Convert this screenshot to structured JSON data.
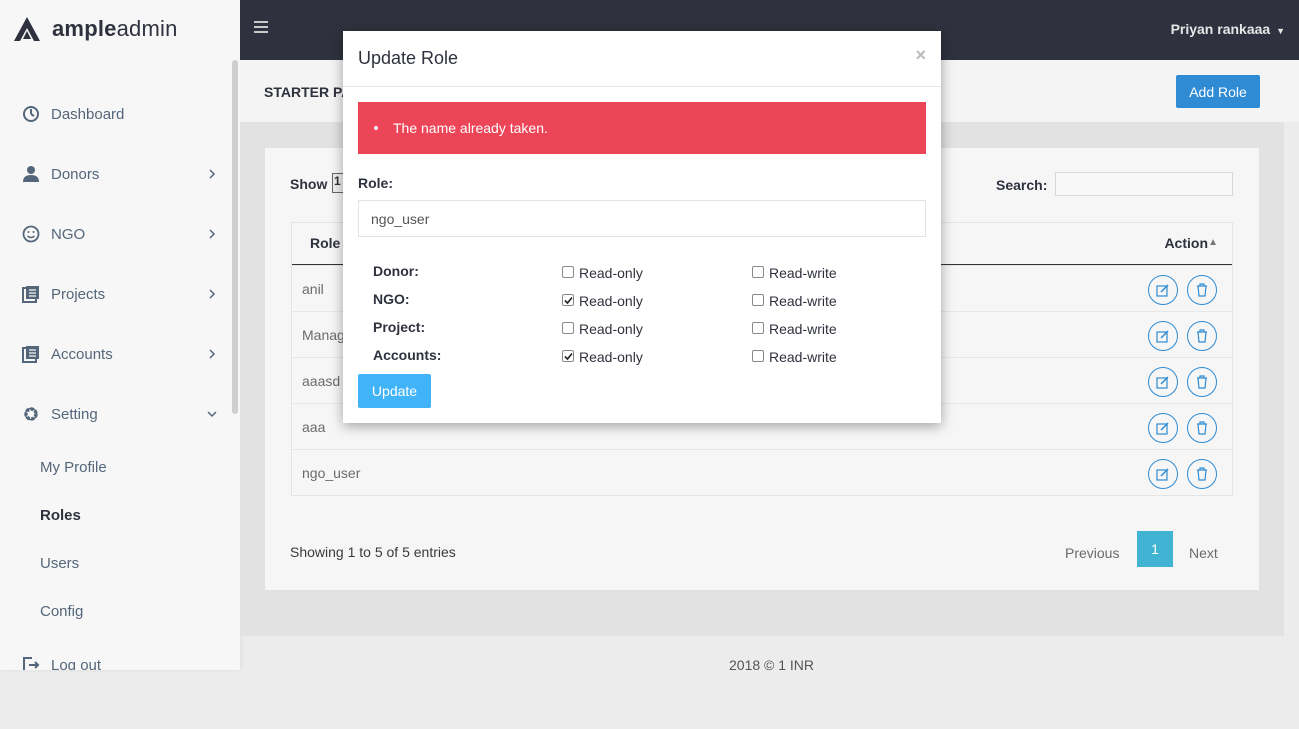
{
  "brand": {
    "bold": "ample",
    "light": "admin"
  },
  "topbar": {
    "user": "Priyan rankaaa"
  },
  "sidebar": {
    "items": [
      {
        "label": "Dashboard",
        "icon": "dashboard-icon"
      },
      {
        "label": "Donors",
        "icon": "user-icon"
      },
      {
        "label": "NGO",
        "icon": "smiley-icon"
      },
      {
        "label": "Projects",
        "icon": "list-icon"
      },
      {
        "label": "Accounts",
        "icon": "list-icon"
      },
      {
        "label": "Setting",
        "icon": "gear-icon"
      }
    ],
    "submenu": [
      "My Profile",
      "Roles",
      "Users",
      "Config"
    ],
    "logout": "Log out"
  },
  "page": {
    "title": "STARTER PA",
    "add_button": "Add Role",
    "show_label": "Show",
    "show_value": "1",
    "search_label": "Search:",
    "table": {
      "col_role": "Role",
      "col_action": "Action",
      "rows": [
        "anil",
        "Manag",
        "aaasd",
        "aaa",
        "ngo_user"
      ]
    },
    "showing": "Showing 1 to 5 of 5 entries",
    "pagination": {
      "prev": "Previous",
      "current": "1",
      "next": "Next"
    }
  },
  "footer": "2018 © 1 INR",
  "modal": {
    "title": "Update Role",
    "close": "×",
    "error": "The name already taken.",
    "role_label": "Role:",
    "role_value": "ngo_user",
    "permissions": [
      {
        "label": "Donor:",
        "read_only": false,
        "read_write": false
      },
      {
        "label": "NGO:",
        "read_only": true,
        "read_write": false
      },
      {
        "label": "Project:",
        "read_only": false,
        "read_write": false
      },
      {
        "label": "Accounts:",
        "read_only": true,
        "read_write": false
      }
    ],
    "read_only_label": "Read-only",
    "read_write_label": "Read-write",
    "update_button": "Update"
  }
}
